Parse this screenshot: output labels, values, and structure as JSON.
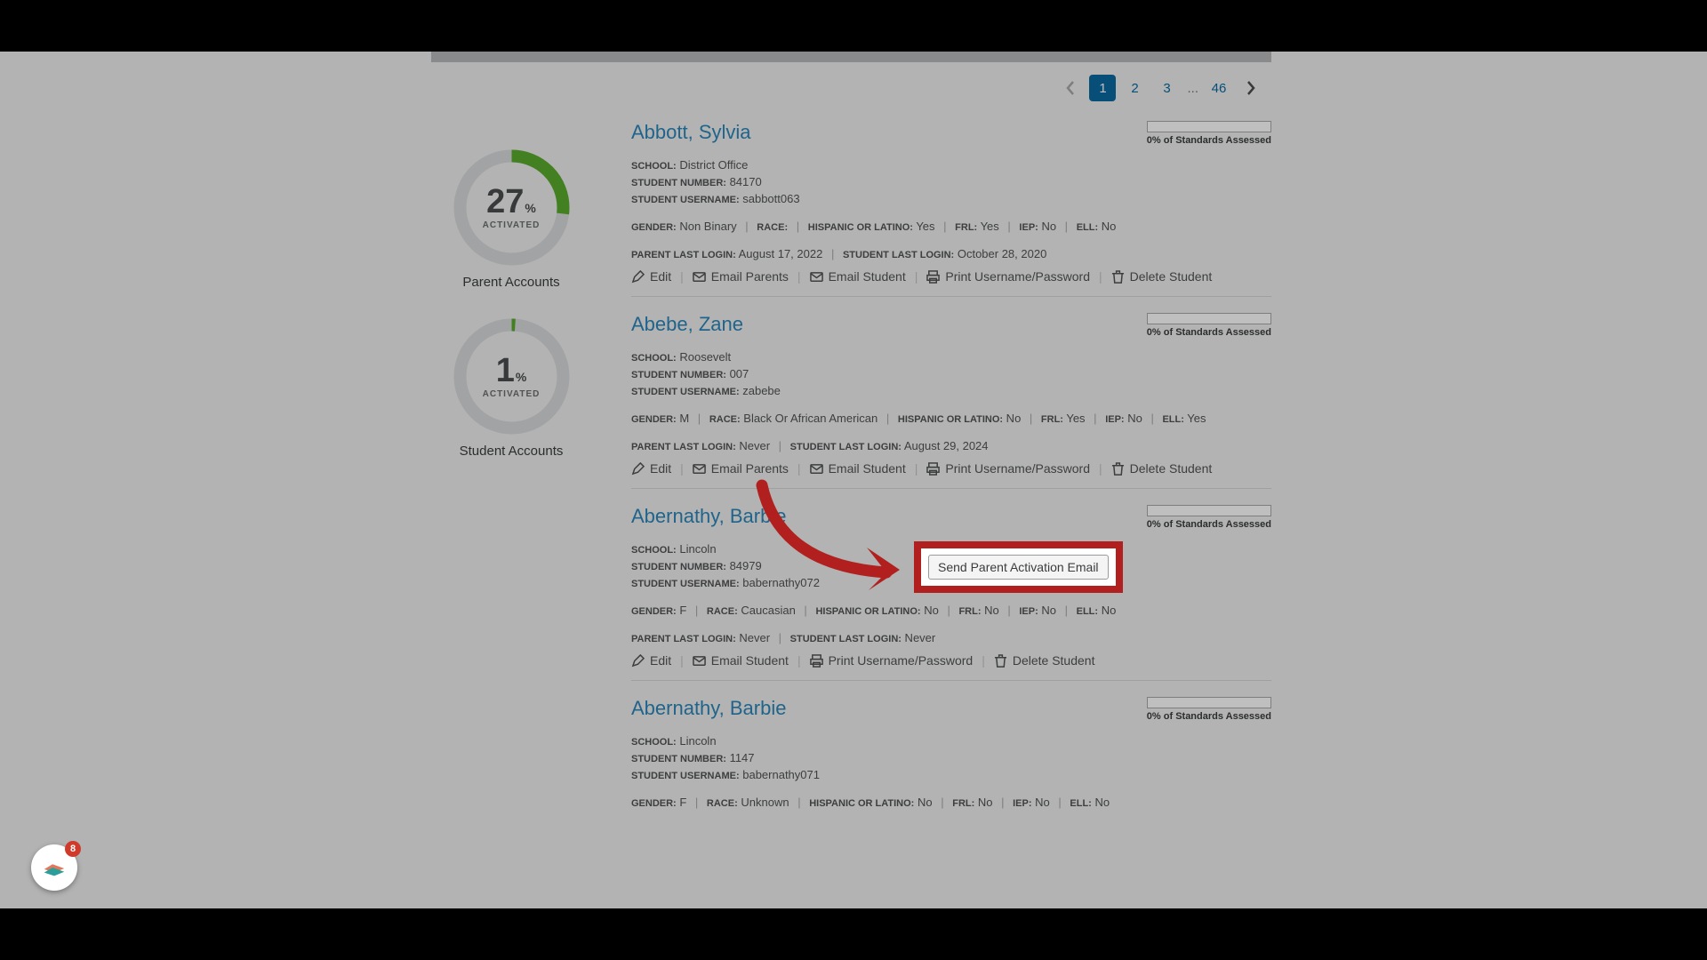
{
  "pagination": {
    "pages": [
      "1",
      "2",
      "3"
    ],
    "ellipsis": "...",
    "last": "46",
    "current": "1"
  },
  "gauges": {
    "parent": {
      "value": "27",
      "pct_sign": "%",
      "sub": "ACTIVATED",
      "label": "Parent Accounts",
      "percent": 27
    },
    "student": {
      "value": "1",
      "pct_sign": "%",
      "sub": "ACTIVATED",
      "label": "Student Accounts",
      "percent": 1
    }
  },
  "labels": {
    "school": "SCHOOL:",
    "student_number": "STUDENT NUMBER:",
    "student_username": "STUDENT USERNAME:",
    "gender": "GENDER:",
    "race": "RACE:",
    "hispanic": "HISPANIC OR LATINO:",
    "frl": "FRL:",
    "iep": "IEP:",
    "ell": "ELL:",
    "parent_last_login": "PARENT LAST LOGIN:",
    "student_last_login": "STUDENT LAST LOGIN:",
    "assessed": "0% of Standards Assessed"
  },
  "actions": {
    "edit": "Edit",
    "email_parents": "Email Parents",
    "email_student": "Email Student",
    "print": "Print Username/Password",
    "delete": "Delete Student"
  },
  "tooltip": "Send Parent Activation Email",
  "students": [
    {
      "name": "Abbott, Sylvia",
      "school": "District Office",
      "number": "84170",
      "username": "sabbott063",
      "gender": "Non Binary",
      "race": "",
      "hispanic": "Yes",
      "frl": "Yes",
      "iep": "No",
      "ell": "No",
      "parent_login": "August 17, 2022",
      "student_login": "October 28, 2020",
      "show_email_parents": true
    },
    {
      "name": "Abebe, Zane",
      "school": "Roosevelt",
      "number": "007",
      "username": "zabebe",
      "gender": "M",
      "race": "Black Or African American",
      "hispanic": "No",
      "frl": "Yes",
      "iep": "No",
      "ell": "Yes",
      "parent_login": "Never",
      "student_login": "August 29, 2024",
      "show_email_parents": true,
      "wrap_actions": true
    },
    {
      "name": "Abernathy, Barbie",
      "school": "Lincoln",
      "number": "84979",
      "username": "babernathy072",
      "gender": "F",
      "race": "Caucasian",
      "hispanic": "No",
      "frl": "No",
      "iep": "No",
      "ell": "No",
      "parent_login": "Never",
      "student_login": "Never",
      "show_email_parents": false
    },
    {
      "name": "Abernathy, Barbie",
      "school": "Lincoln",
      "number": "1147",
      "username": "babernathy071",
      "gender": "F",
      "race": "Unknown",
      "hispanic": "No",
      "frl": "No",
      "iep": "No",
      "ell": "No",
      "parent_login": "",
      "student_login": "",
      "truncated": true
    }
  ],
  "float_badge": "8"
}
